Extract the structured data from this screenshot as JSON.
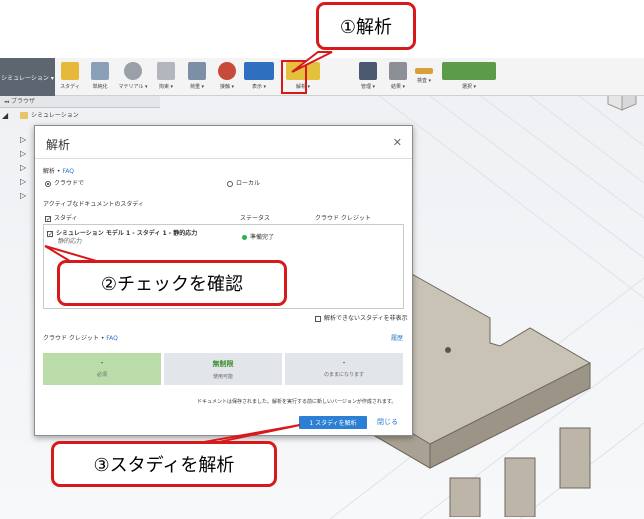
{
  "callouts": {
    "step1": "①解析",
    "step2": "②チェックを確認",
    "step3": "③スタディを解析"
  },
  "toolbar": {
    "workspace": "シミュレーション ▾",
    "items": [
      "スタディ",
      "単純化",
      "マテリアル ▾",
      "拘束 ▾",
      "荷重 ▾",
      "接触 ▾",
      "表示 ▾",
      "解析 ▾",
      "管理 ▾",
      "結果 ▾",
      "検査 ▾",
      "選択 ▾"
    ]
  },
  "browser": {
    "title": "ブラウザ",
    "root": "シミュレーション"
  },
  "dialog": {
    "title": "解析",
    "close_icon": "✕",
    "analysis_label": "解析",
    "faq": "FAQ",
    "radio_cloud": "クラウドで",
    "radio_local": "ローカル",
    "active_docs": "アクティブなドキュメントのスタディ",
    "col_study": "スタディ",
    "col_status": "ステータス",
    "col_credit": "クラウド クレジット",
    "row_title": "シミュレーション モデル 1 - スタディ 1 - 静的応力",
    "row_sub": "静的応力",
    "row_status": "準備完了",
    "hide_label": "解析できないスタディを非表示",
    "credit_label": "クラウド クレジット",
    "credit_faq": "FAQ",
    "history": "履歴",
    "credits": [
      {
        "value": "-",
        "sub": "必須"
      },
      {
        "value": "無制限",
        "sub": "使用可能"
      },
      {
        "value": "-",
        "sub": "のままになります"
      }
    ],
    "footer_note": "ドキュメントは保存されました。解析を実行する前に新しいバージョンが作成されます。",
    "primary_button": "1 スタディを解析",
    "close_button": "閉じる"
  },
  "colors": {
    "accent": "#2b7fd4",
    "callout_border": "#d7191c",
    "status_ready": "#29b24a",
    "credit_required_bg": "#b9dca9"
  }
}
